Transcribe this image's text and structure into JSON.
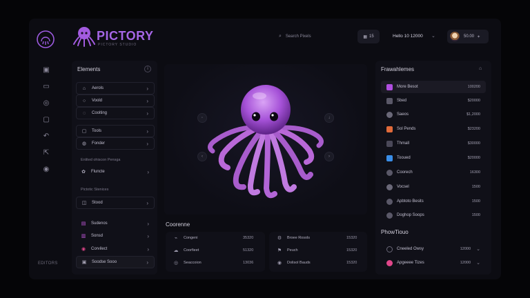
{
  "brand": {
    "name": "PICTORY",
    "subtitle": "PICTORY STUDIO"
  },
  "search": {
    "label": "Search Pixels"
  },
  "header": {
    "badge": "15",
    "greeting": "Hello 10 12000",
    "account": "50.00"
  },
  "rail": {
    "footer": "EDITORS"
  },
  "left_panel": {
    "title": "Elements",
    "items": [
      {
        "label": "Aerols",
        "icon": "house-icon"
      },
      {
        "label": "Voold",
        "icon": "circle-icon"
      },
      {
        "label": "Coolting",
        "icon": "chip-icon"
      },
      {
        "label": "Tools",
        "icon": "wrench-icon"
      },
      {
        "label": "Fonder",
        "icon": "folder-icon"
      }
    ],
    "section_1": "Enlited ohiscon Pensga",
    "items_2": [
      {
        "label": "Fluncte",
        "icon": "plugin-icon"
      }
    ],
    "section_2": "Pictotic Stenices",
    "items_3": [
      {
        "label": "Stood",
        "icon": "stack-icon"
      }
    ],
    "items_4": [
      {
        "label": "Sudenos",
        "icon": "layers-icon"
      },
      {
        "label": "Sonsd",
        "icon": "sound-icon"
      },
      {
        "label": "Corvilect",
        "icon": "tag-icon"
      },
      {
        "label": "Soodse Sooo",
        "icon": "image-icon"
      }
    ]
  },
  "bottom": {
    "title": "Coorenne",
    "left_rows": [
      {
        "label": "Congeni",
        "value": "35320"
      },
      {
        "label": "Coorfieet",
        "value": "51320"
      },
      {
        "label": "Seaccoion",
        "value": "13036"
      }
    ],
    "right_rows": [
      {
        "label": "Broee Rosols",
        "value": "15320"
      },
      {
        "label": "Peuch",
        "value": "15320"
      },
      {
        "label": "Dolisol Bauds",
        "value": "15320"
      }
    ]
  },
  "right_panel": {
    "title": "Frawahlemes",
    "items": [
      {
        "label": "More Besot",
        "value": "100200",
        "color": "#b04ee0"
      },
      {
        "label": "Sbed",
        "value": "$20000",
        "color": "#5a5868"
      },
      {
        "label": "Saeos",
        "value": "$1,2000",
        "color": "#6a6878"
      },
      {
        "label": "Sol Pends",
        "value": "$23200",
        "color": "#e06a3a"
      },
      {
        "label": "Thmall",
        "value": "$30000",
        "color": "#4a4858"
      },
      {
        "label": "Tooued",
        "value": "$20000",
        "color": "#3a8ee8"
      },
      {
        "label": "Coorech",
        "value": "16300",
        "color": "#5a5868"
      },
      {
        "label": "Vocsel",
        "value": "1500",
        "color": "#6a6878"
      },
      {
        "label": "Apbtoto Besits",
        "value": "1500",
        "color": "#5a5868"
      },
      {
        "label": "Doghop Soops",
        "value": "1500",
        "color": "#5a5868"
      }
    ],
    "section": "PhowTiouo",
    "extra": [
      {
        "label": "Cneeled Owsy",
        "value": "12000"
      },
      {
        "label": "Apgeeee Tizes",
        "value": "12000"
      }
    ]
  }
}
